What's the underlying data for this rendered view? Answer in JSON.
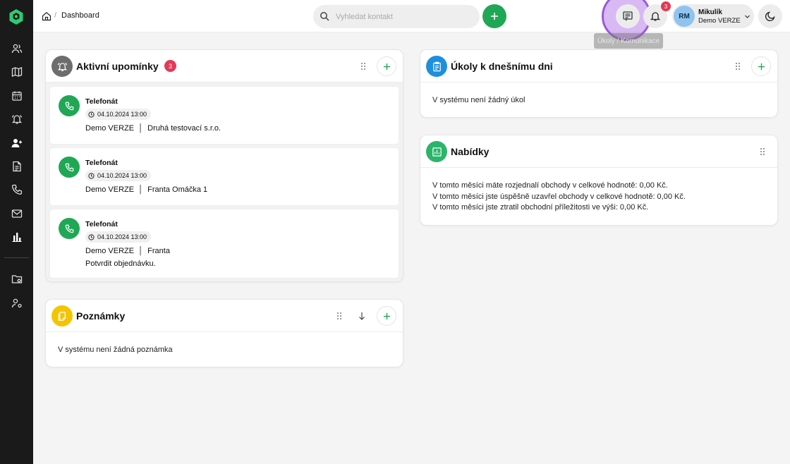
{
  "breadcrumb": {
    "current": "Dashboard"
  },
  "search": {
    "placeholder": "Vyhledat kontakt"
  },
  "notifications": {
    "count": "3"
  },
  "tooltip": {
    "text": "Úkoly / Komunikace"
  },
  "user": {
    "initials": "RM",
    "name": "Mikulík",
    "company": "Demo VERZE"
  },
  "sidebar": {
    "items": [
      {
        "icon": "users-icon"
      },
      {
        "icon": "map-icon"
      },
      {
        "icon": "calendar-icon"
      },
      {
        "icon": "bell-icon"
      },
      {
        "icon": "contact-icon"
      },
      {
        "icon": "document-icon"
      },
      {
        "icon": "phone-icon"
      },
      {
        "icon": "mail-icon"
      },
      {
        "icon": "chart-icon"
      },
      {
        "icon": "folder-icon"
      },
      {
        "icon": "user-settings-icon"
      }
    ]
  },
  "reminders": {
    "title": "Aktivní upomínky",
    "count": "3",
    "items": [
      {
        "title": "Telefonát",
        "date": "04.10.2024 13:00",
        "line1": "Demo VERZE  │  Druhá testovací s.r.o."
      },
      {
        "title": "Telefonát",
        "date": "04.10.2024 13:00",
        "line1": "Demo VERZE  │  Franta Omáčka 1"
      },
      {
        "title": "Telefonát",
        "date": "04.10.2024 13:00",
        "line1": "Demo VERZE  │  Franta",
        "line2": "Potvrdit objednávku."
      }
    ]
  },
  "notes": {
    "title": "Poznámky",
    "empty": "V systému není žádná poznámka"
  },
  "tasks": {
    "title": "Úkoly k dnešnímu dni",
    "empty": "V systému není žádný úkol"
  },
  "offers": {
    "title": "Nabídky",
    "lines": [
      "V tomto měsíci máte rozjednalí obchody v celkové hodnotě: 0,00 Kč.",
      "V tomto měsíci jste úspěšně uzavřel obchody v celkové hodnotě: 0,00 Kč.",
      "V tomto měsíci jste ztratil obchodní příležitosti ve výši: 0,00 Kč."
    ]
  },
  "colors": {
    "accent_green": "#20a756",
    "badge_red": "#e23a55",
    "sidebar_bg": "#1a1a1a",
    "highlight_purple": "#9a5ad8"
  }
}
